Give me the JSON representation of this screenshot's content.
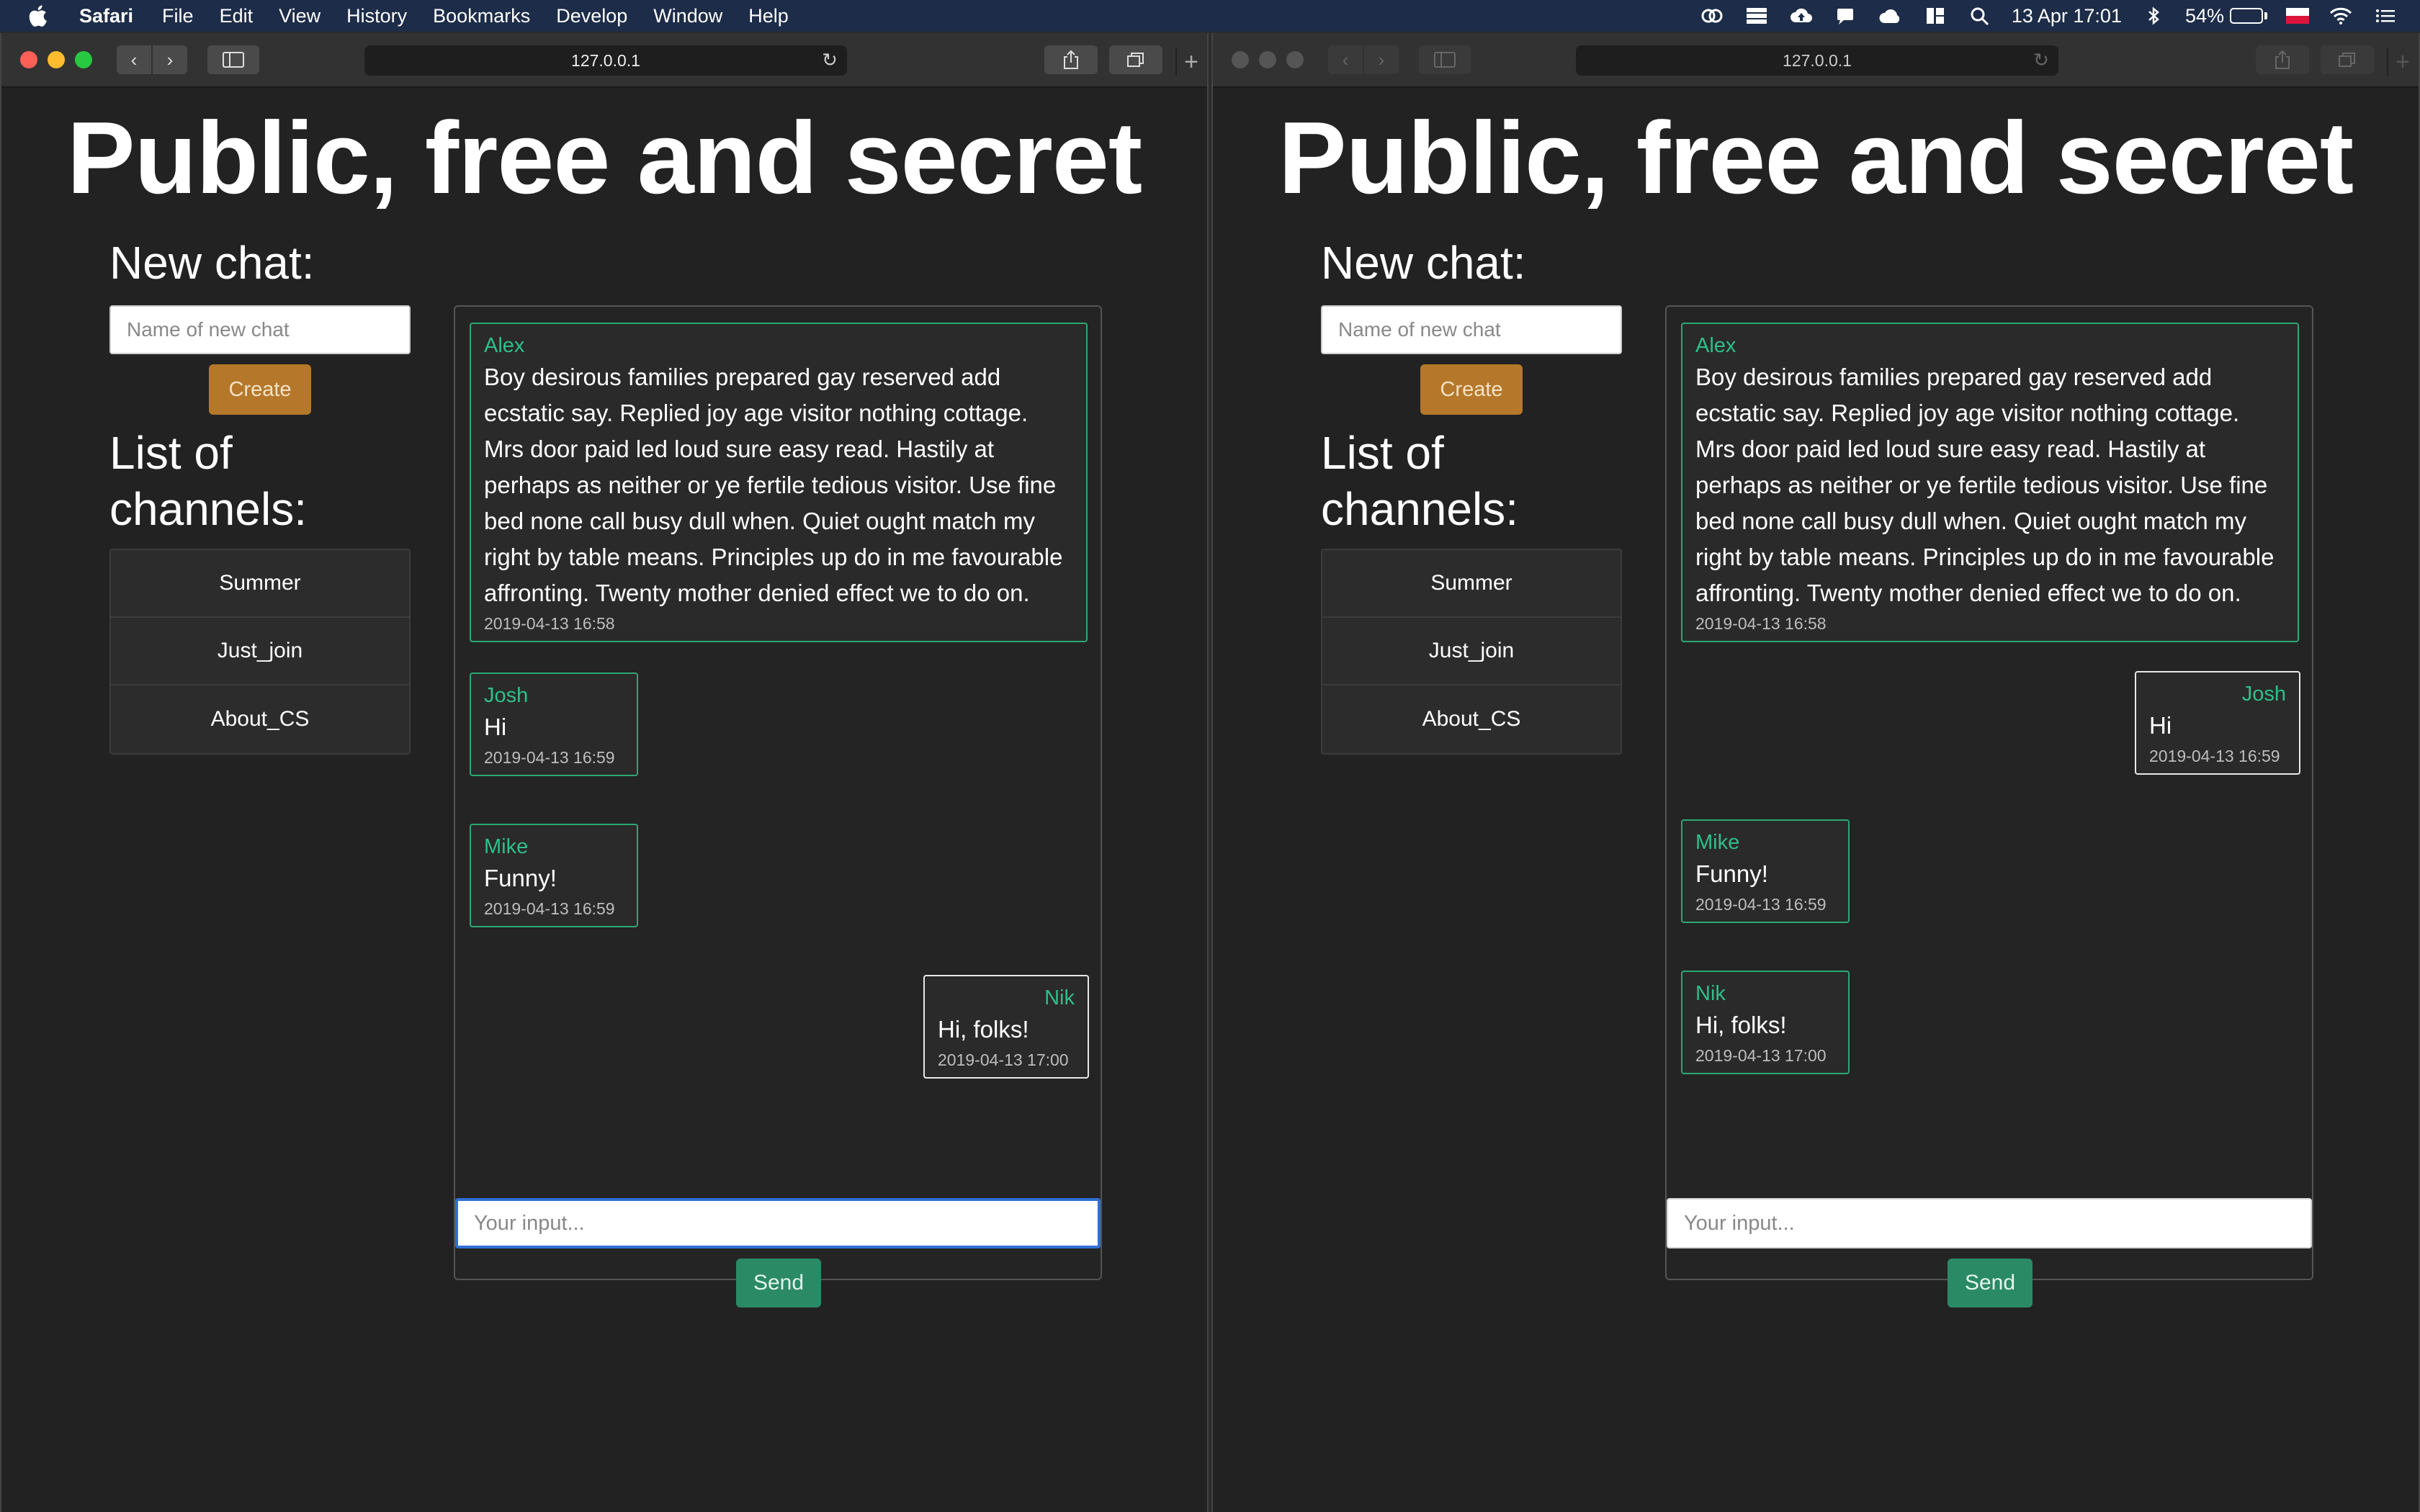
{
  "menubar": {
    "app": "Safari",
    "items": [
      "File",
      "Edit",
      "View",
      "History",
      "Bookmarks",
      "Develop",
      "Window",
      "Help"
    ],
    "datetime": "13 Apr  17:01",
    "battery": "54%",
    "battery_level": 0.54
  },
  "browser": {
    "url": "127.0.0.1",
    "newtab": "+"
  },
  "page": {
    "title": "Public, free and secret",
    "new_chat_heading": "New chat:",
    "new_chat_placeholder": "Name of new chat",
    "create_label": "Create",
    "channels_heading": "List of channels:",
    "channels": [
      "Summer",
      "Just_join",
      "About_CS"
    ],
    "messages": [
      {
        "author": "Alex",
        "text": "Boy desirous families prepared gay reserved add ecstatic say. Replied joy age visitor nothing cottage. Mrs door paid led loud sure easy read. Hastily at perhaps as neither or ye fertile tedious visitor. Use fine bed none call busy dull when. Quiet ought match my right by table means. Principles up do in me favourable affronting. Twenty mother denied effect we to do on.",
        "time": "2019-04-13 16:58"
      },
      {
        "author": "Josh",
        "text": "Hi",
        "time": "2019-04-13 16:59"
      },
      {
        "author": "Mike",
        "text": "Funny!",
        "time": "2019-04-13 16:59"
      },
      {
        "author": "Nik",
        "text": "Hi, folks!",
        "time": "2019-04-13 17:00"
      }
    ],
    "input_placeholder": "Your input...",
    "send_label": "Send"
  },
  "colors": {
    "accent_green": "#2aa876",
    "create_orange": "#b5782a",
    "send_green": "#2a8a66",
    "menubar_bg": "#1d2c48"
  },
  "icons": [
    "apple-icon",
    "creative-cloud-icon",
    "db-icon",
    "cloud-upload-icon",
    "notification-icon",
    "weather-icon",
    "layout-icon",
    "search-icon",
    "bluetooth-icon",
    "battery-icon",
    "flag-icon",
    "wifi-icon",
    "list-icon"
  ]
}
